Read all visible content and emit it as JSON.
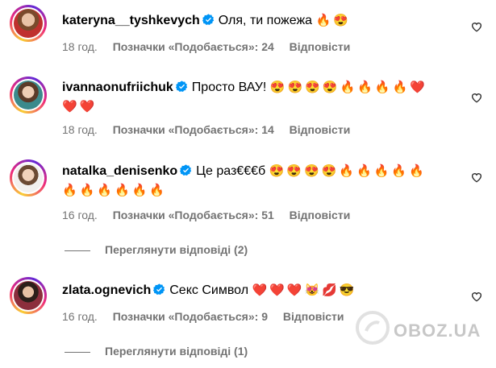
{
  "comments": [
    {
      "username": "kateryna__tyshkevych",
      "text": "Оля, ти пожежа",
      "emoji": "🔥😍",
      "emoji2": "",
      "time": "18 год.",
      "likes": "Позначки «Подобається»: 24",
      "reply": "Відповісти"
    },
    {
      "username": "ivannaonufriichuk",
      "text": "Просто ВАУ!",
      "emoji": "😍😍😍😍🔥🔥🔥🔥❤️",
      "emoji2": "❤️❤️",
      "time": "18 год.",
      "likes": "Позначки «Подобається»: 14",
      "reply": "Відповісти"
    },
    {
      "username": "natalka_denisenko",
      "text": "Це раз€€€б",
      "emoji": "😍😍😍😍🔥🔥🔥🔥🔥",
      "emoji2": "🔥🔥🔥🔥🔥🔥",
      "time": "16 год.",
      "likes": "Позначки «Подобається»: 51",
      "reply": "Відповісти",
      "view_replies": "Переглянути відповіді (2)"
    },
    {
      "username": "zlata.ognevich",
      "text": "Секс Символ",
      "emoji": "❤️❤️❤️😻💋😎",
      "emoji2": "",
      "time": "16 год.",
      "likes": "Позначки «Подобається»: 9",
      "reply": "Відповісти",
      "view_replies": "Переглянути відповіді (1)"
    }
  ],
  "watermark": "OBOZ.UA",
  "colors": {
    "verified": "#0095f6",
    "meta": "#737373"
  },
  "icons": {
    "verified": "verified-badge-icon",
    "like": "heart-outline-icon"
  }
}
